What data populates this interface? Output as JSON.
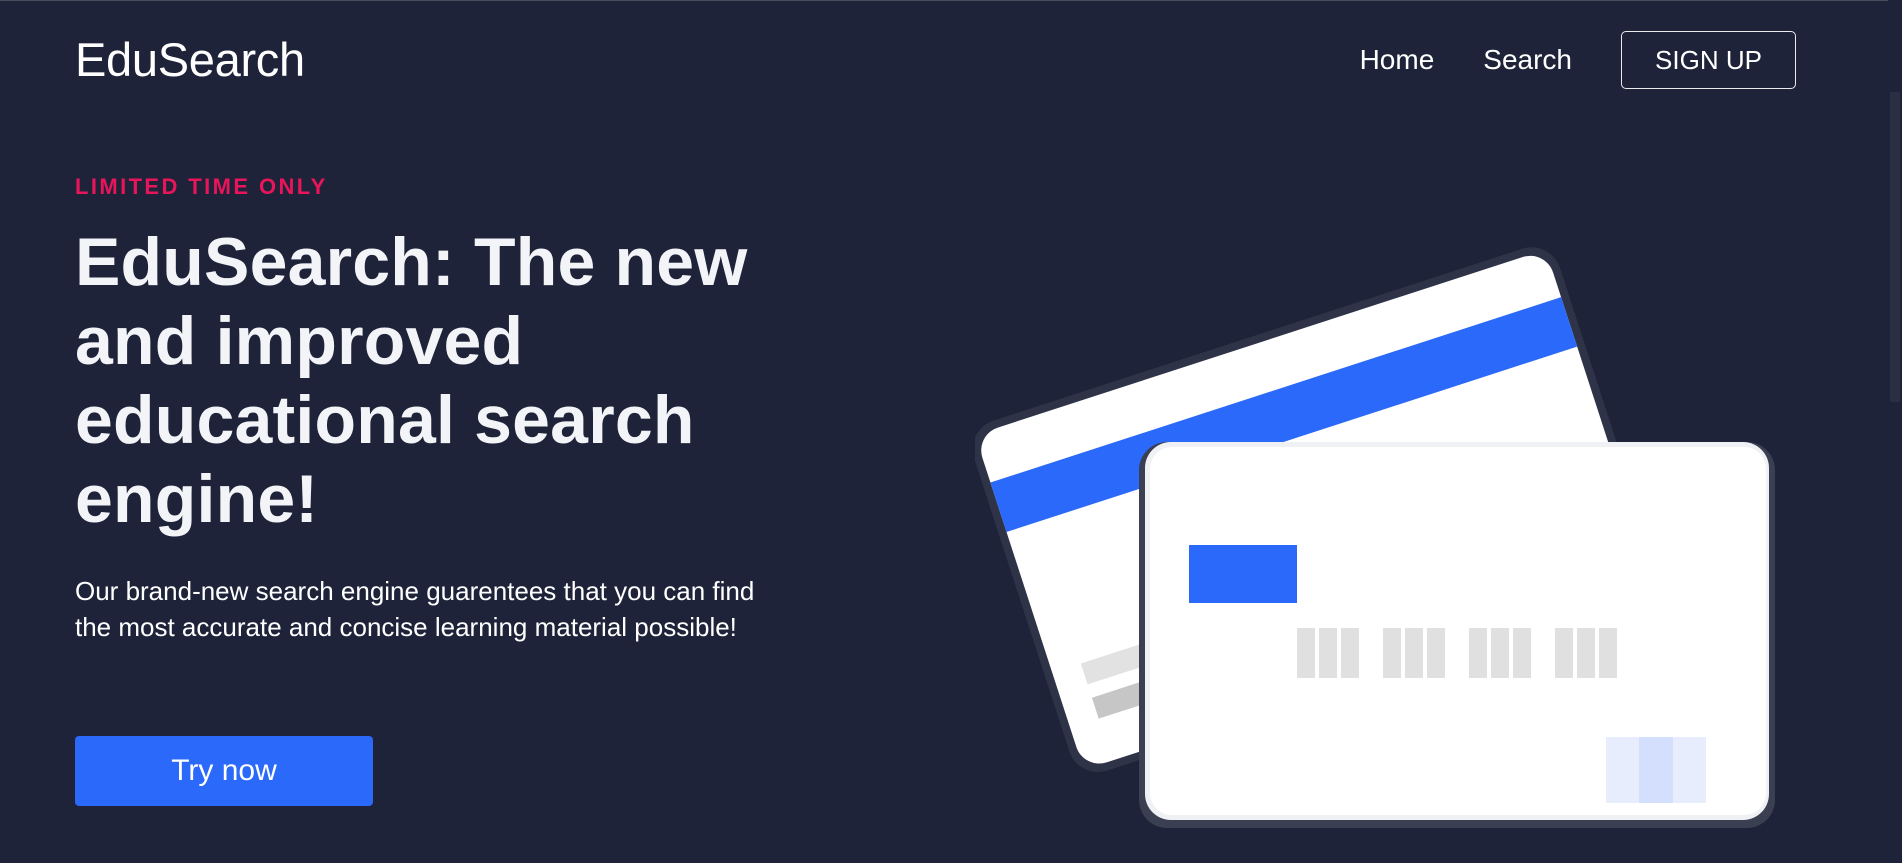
{
  "header": {
    "brand": "EduSearch",
    "nav": [
      {
        "label": "Home"
      },
      {
        "label": "Search"
      }
    ],
    "cta_label": "SIGN UP"
  },
  "hero": {
    "eyebrow": "LIMITED TIME ONLY",
    "title": "EduSearch: The new and improved educational search engine!",
    "description": "Our brand-new search engine guarentees that you can find the most accurate and concise learning material possible!",
    "button_label": "Try now"
  },
  "illustration": {
    "icon": "credit-cards-icon",
    "colors": {
      "accent": "#2a69f9",
      "card": "#ffffff",
      "card_border": "#2e3348",
      "card_shadow": "#3a3f52",
      "number_block": "#e0e0e0",
      "chip_light": "#e7edfd",
      "chip_mid": "#d3dffc",
      "back_text_light": "#e2e2e2",
      "back_text_dark": "#c6c6c6"
    }
  },
  "theme": {
    "background": "#1e2339",
    "accent": "#2a69f9",
    "eyebrow": "#e8155a",
    "text": "#ffffff"
  }
}
